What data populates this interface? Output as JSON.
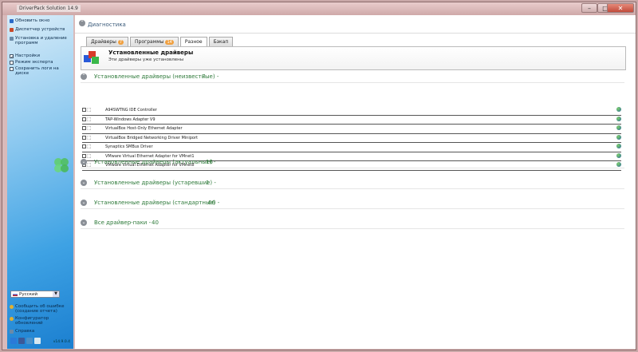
{
  "window": {
    "title": "DriverPack Solution 14.9",
    "controls": [
      "–",
      "□",
      "✕"
    ]
  },
  "sidebar": {
    "items": [
      {
        "label": "Обновить окно",
        "color": "#2a6ac8"
      },
      {
        "label": "Диспетчер устройств",
        "color": "#c84a2a"
      },
      {
        "label": "Установка и удаление программ",
        "color": "#6a8aa8"
      }
    ],
    "options": [
      {
        "label": "Настройки",
        "checked": true
      },
      {
        "label": "Режим эксперта",
        "checked": true
      },
      {
        "label": "Сохранить логи на диске",
        "checked": false
      }
    ],
    "language": "Русский",
    "bottom_links": [
      {
        "label": "Сообщить об ошибке (создание отчета)",
        "color": "#e0b030"
      },
      {
        "label": "Конфигуратор обновлений",
        "color": "#e0b030"
      },
      {
        "label": "Справка",
        "color": "#6a8aa8"
      }
    ],
    "version": "v14.9.0.4"
  },
  "main": {
    "header_title": "Диагностика",
    "tabs": [
      {
        "label": "Драйверы",
        "badge": "7",
        "active": false
      },
      {
        "label": "Программы",
        "badge": "14",
        "active": false
      },
      {
        "label": "Разное",
        "badge": "",
        "active": true
      },
      {
        "label": "Бэкап",
        "badge": "",
        "active": false
      }
    ],
    "panel": {
      "title": "Установленные драйверы",
      "subtitle": "Эти драйверы уже установлены"
    },
    "sections": [
      {
        "label": "Установленные драйверы (неизвестные) -",
        "count": "7"
      },
      {
        "label": "Установленные драйверы (актуальные) -",
        "count": "16"
      },
      {
        "label": "Установленные драйверы (устаревшие) -",
        "count": "1"
      },
      {
        "label": "Установленные драйверы (стандартные) -",
        "count": "66"
      },
      {
        "label": "Все драйвер-паки -",
        "count": "40"
      }
    ],
    "drivers": [
      "A94SWTNG IDE Controller",
      "TAP-Windows Adapter V9",
      "VirtualBox Host-Only Ethernet Adapter",
      "VirtualBox Bridged Networking Driver Miniport",
      "Synaptics SMBus Driver",
      "VMware Virtual Ethernet Adapter for VMnet1",
      "VMware Virtual Ethernet Adapter for VMnet8"
    ]
  }
}
